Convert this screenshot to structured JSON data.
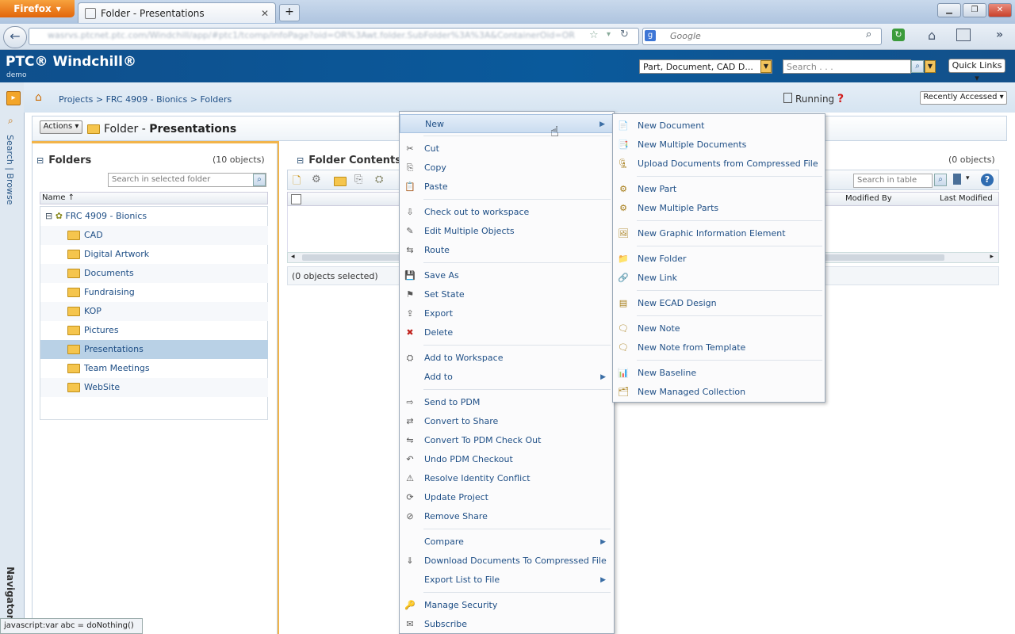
{
  "browser": {
    "app_button": "Firefox",
    "tab_title": "Folder - Presentations",
    "new_tab": "+",
    "url": "wasrvs.ptcnet.ptc.com/Windchill/app/#ptc1/tcomp/infoPage?oid=OR%3Awt.folder.SubFolder%3A%3A&ContainerOid=OR",
    "search_engine_placeholder": "Google",
    "status_link": "javascript:var abc = doNothing()"
  },
  "header": {
    "logo": "PTC® Windchill®",
    "logo_sub": "demo",
    "type_select": "Part, Document, CAD D...",
    "search_placeholder": "Search . . .",
    "quick_links": "Quick Links ▾"
  },
  "breadcrumb": {
    "path": "Projects > FRC 4909 - Bionics > Folders",
    "running": "Running",
    "recently_accessed": "Recently Accessed ▾"
  },
  "rail": {
    "search_browse": "Search | Browse",
    "navigator": "Navigator"
  },
  "title_bar": {
    "actions": "Actions ▾",
    "title_prefix": "Folder - ",
    "title_name": "Presentations"
  },
  "folders_panel": {
    "heading": "Folders",
    "count": "(10 objects)",
    "search_placeholder": "Search in selected folder",
    "column_name": "Name ↑",
    "root": "FRC 4909 - Bionics",
    "items": [
      "CAD",
      "Digital Artwork",
      "Documents",
      "Fundraising",
      "KOP",
      "Pictures",
      "Presentations",
      "Team Meetings",
      "WebSite"
    ],
    "selected": "Presentations"
  },
  "contents_panel": {
    "heading": "Folder Contents",
    "count": "(0 objects)",
    "search_placeholder": "Search in table",
    "columns": [
      "Modified By",
      "Last Modified"
    ],
    "status": "(0 objects selected)"
  },
  "context_menu": {
    "groups": [
      [
        {
          "label": "New",
          "icon": "none",
          "submenu": true,
          "highlighted": true
        }
      ],
      [
        {
          "label": "Cut",
          "icon": "scissors-icon"
        },
        {
          "label": "Copy",
          "icon": "copy-icon"
        },
        {
          "label": "Paste",
          "icon": "paste-icon"
        }
      ],
      [
        {
          "label": "Check out to workspace",
          "icon": "checkout-icon"
        },
        {
          "label": "Edit Multiple Objects",
          "icon": "edit-icon"
        },
        {
          "label": "Route",
          "icon": "route-icon"
        }
      ],
      [
        {
          "label": "Save As",
          "icon": "save-as-icon"
        },
        {
          "label": "Set State",
          "icon": "set-state-icon"
        },
        {
          "label": "Export",
          "icon": "export-icon"
        },
        {
          "label": "Delete",
          "icon": "delete-icon"
        }
      ],
      [
        {
          "label": "Add to Workspace",
          "icon": "add-workspace-icon"
        },
        {
          "label": "Add to",
          "icon": "none",
          "submenu": true
        }
      ],
      [
        {
          "label": "Send to PDM",
          "icon": "send-pdm-icon"
        },
        {
          "label": "Convert to Share",
          "icon": "convert-share-icon"
        },
        {
          "label": "Convert To PDM Check Out",
          "icon": "convert-pdm-icon"
        },
        {
          "label": "Undo PDM Checkout",
          "icon": "undo-pdm-icon"
        },
        {
          "label": "Resolve Identity Conflict",
          "icon": "resolve-icon"
        },
        {
          "label": "Update Project",
          "icon": "update-project-icon"
        },
        {
          "label": "Remove Share",
          "icon": "remove-share-icon"
        }
      ],
      [
        {
          "label": "Compare",
          "icon": "none",
          "submenu": true
        },
        {
          "label": "Download Documents To Compressed File",
          "icon": "download-icon"
        },
        {
          "label": "Export List to File",
          "icon": "none",
          "submenu": true
        }
      ],
      [
        {
          "label": "Manage Security",
          "icon": "security-icon"
        },
        {
          "label": "Subscribe",
          "icon": "subscribe-icon"
        }
      ]
    ]
  },
  "new_submenu": {
    "groups": [
      [
        "New Document",
        "New Multiple Documents",
        "Upload Documents from Compressed File"
      ],
      [
        "New Part",
        "New Multiple Parts"
      ],
      [
        "New Graphic Information Element"
      ],
      [
        "New Folder",
        "New Link"
      ],
      [
        "New ECAD Design"
      ],
      [
        "New Note",
        "New Note from Template"
      ],
      [
        "New Baseline",
        "New Managed Collection"
      ]
    ]
  },
  "colors": {
    "header_blue": "#0a5a9c",
    "link_blue": "#1f4f86",
    "selection": "#b9d1e6",
    "accent_orange": "#f2b44a"
  }
}
